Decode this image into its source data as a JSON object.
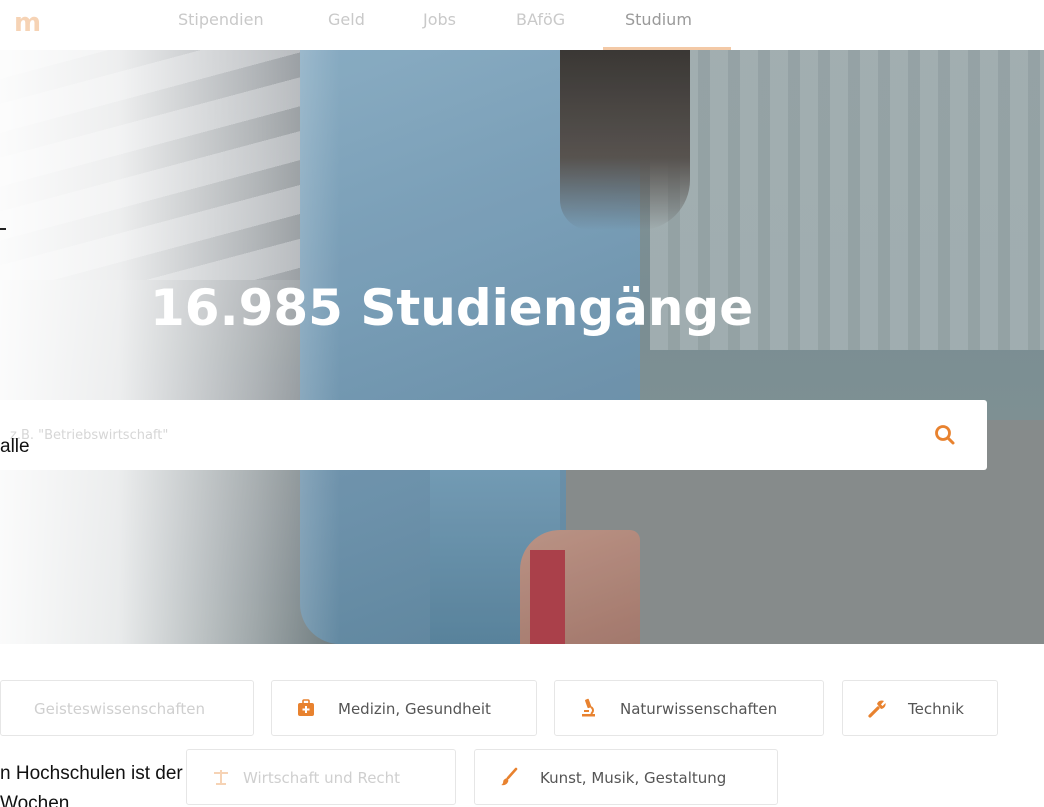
{
  "logo": {
    "text": "m"
  },
  "nav": {
    "items": [
      {
        "label": "Stipendien"
      },
      {
        "label": "Geld"
      },
      {
        "label": "Jobs"
      },
      {
        "label": "BAföG"
      },
      {
        "label": "Studium"
      }
    ],
    "active": "Studium"
  },
  "hero": {
    "title": "16.985 Studiengänge"
  },
  "search": {
    "placeholder": "z.B. \"Betriebswirtschaft\"",
    "value": ""
  },
  "categories": [
    {
      "label": "Geisteswissenschaften",
      "icon": "book-icon"
    },
    {
      "label": "Medizin, Gesundheit",
      "icon": "medical-kit-icon"
    },
    {
      "label": "Naturwissenschaften",
      "icon": "microscope-icon"
    },
    {
      "label": "Technik",
      "icon": "wrench-icon"
    },
    {
      "label": "Wirtschaft und Recht",
      "icon": "scale-icon"
    },
    {
      "label": "Kunst, Musik, Gestaltung",
      "icon": "brush-icon"
    }
  ],
  "overlay": {
    "dash": "-",
    "alle": "alle",
    "hochschulen": "n Hochschulen ist der",
    "wochen": "Wochen"
  },
  "colors": {
    "accent": "#e8822f",
    "nav_text": "#c9c9c9",
    "category_text": "#555555"
  }
}
